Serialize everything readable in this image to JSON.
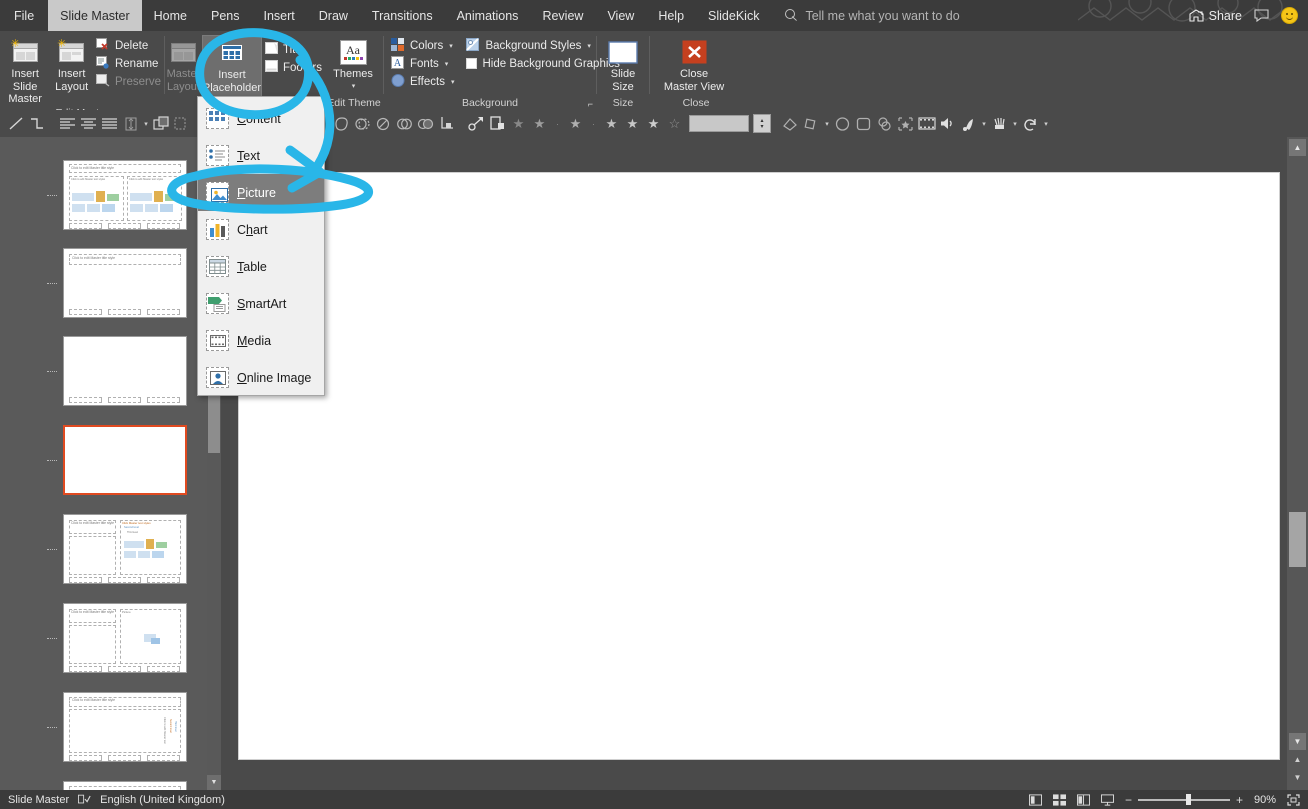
{
  "app": {
    "title_tabs": [
      {
        "label": "File",
        "active": false
      },
      {
        "label": "Slide Master",
        "active": true
      },
      {
        "label": "Home",
        "active": false
      },
      {
        "label": "Pens",
        "active": false
      },
      {
        "label": "Insert",
        "active": false
      },
      {
        "label": "Draw",
        "active": false
      },
      {
        "label": "Transitions",
        "active": false
      },
      {
        "label": "Animations",
        "active": false
      },
      {
        "label": "Review",
        "active": false
      },
      {
        "label": "View",
        "active": false
      },
      {
        "label": "Help",
        "active": false
      },
      {
        "label": "SlideKick",
        "active": false
      }
    ],
    "tell_me": "Tell me what you want to do",
    "share_label": "Share"
  },
  "ribbon": {
    "groups": [
      {
        "name": "Edit Master",
        "label": "Edit Master",
        "big_buttons": [
          {
            "label_line1": "Insert Slide",
            "label_line2": "Master",
            "icon": "insert-slide-master-icon",
            "disabled": false
          },
          {
            "label_line1": "Insert",
            "label_line2": "Layout",
            "icon": "insert-layout-icon",
            "disabled": false
          }
        ],
        "small_buttons": [
          {
            "label": "Delete",
            "icon": "delete-icon",
            "disabled": false
          },
          {
            "label": "Rename",
            "icon": "rename-icon",
            "disabled": false
          },
          {
            "label": "Preserve",
            "icon": "preserve-icon",
            "disabled": true
          }
        ]
      },
      {
        "name": "Master Layout",
        "label": "",
        "big_buttons": [
          {
            "label_line1": "Master",
            "label_line2": "Layout",
            "icon": "master-layout-icon",
            "disabled": true
          },
          {
            "label_line1": "Insert",
            "label_line2": "Placeholder",
            "icon": "insert-placeholder-icon",
            "disabled": false,
            "has_caret": true,
            "active": true
          }
        ],
        "checkboxes": [
          {
            "label": "Title",
            "checked": false
          },
          {
            "label": "Footers",
            "checked": false
          }
        ]
      },
      {
        "name": "Edit Theme",
        "label": "Edit Theme",
        "big_buttons": [
          {
            "label_line1": "Themes",
            "label_line2": "",
            "icon": "themes-icon",
            "has_caret": true
          }
        ]
      },
      {
        "name": "Background",
        "label": "Background",
        "small_buttons": [
          {
            "label": "Colors",
            "icon": "colors-icon",
            "has_caret": true
          },
          {
            "label": "Fonts",
            "icon": "fonts-icon",
            "has_caret": true
          },
          {
            "label": "Effects",
            "icon": "effects-icon",
            "has_caret": true
          },
          {
            "label": "Background Styles",
            "icon": "background-styles-icon",
            "has_caret": true
          },
          {
            "label": "Hide Background Graphics",
            "icon": "checkbox-icon",
            "checked": false
          }
        ],
        "dialog_launcher": true
      },
      {
        "name": "Size",
        "label": "Size",
        "big_buttons": [
          {
            "label_line1": "Slide",
            "label_line2": "Size",
            "icon": "slide-size-icon",
            "has_caret": true
          }
        ]
      },
      {
        "name": "Close",
        "label": "Close",
        "big_buttons": [
          {
            "label_line1": "Close",
            "label_line2": "Master View",
            "icon": "close-master-view-icon"
          }
        ]
      }
    ]
  },
  "placeholder_menu": {
    "items": [
      {
        "label": "Content",
        "accesskey": "C",
        "icon": "content-placeholder-icon",
        "highlighted": false
      },
      {
        "label": "Text",
        "accesskey": "T",
        "icon": "text-placeholder-icon",
        "highlighted": false
      },
      {
        "label": "Picture",
        "accesskey": "P",
        "icon": "picture-placeholder-icon",
        "highlighted": true
      },
      {
        "label": "Chart",
        "accesskey": "h",
        "icon": "chart-placeholder-icon",
        "highlighted": false
      },
      {
        "label": "Table",
        "accesskey": "T",
        "icon": "table-placeholder-icon",
        "highlighted": false
      },
      {
        "label": "SmartArt",
        "accesskey": "S",
        "icon": "smartart-placeholder-icon",
        "highlighted": false
      },
      {
        "label": "Media",
        "accesskey": "M",
        "icon": "media-placeholder-icon",
        "highlighted": false
      },
      {
        "label": "Online Image",
        "accesskey": "O",
        "icon": "online-image-placeholder-icon",
        "highlighted": false
      }
    ]
  },
  "thumbnails": [
    {
      "index": 1,
      "selected": false,
      "title_text": "Click to edit Master title style",
      "kind": "two-content"
    },
    {
      "index": 2,
      "selected": false,
      "title_text": "Click to edit Master title style",
      "kind": "title-only"
    },
    {
      "index": 3,
      "selected": false,
      "title_text": "",
      "kind": "blank-footer"
    },
    {
      "index": 4,
      "selected": true,
      "title_text": "",
      "kind": "blank"
    },
    {
      "index": 5,
      "selected": false,
      "title_text": "Click to edit Master title style",
      "kind": "content-with-caption"
    },
    {
      "index": 6,
      "selected": false,
      "title_text": "Click to edit Master title style",
      "kind": "picture-with-caption"
    },
    {
      "index": 7,
      "selected": false,
      "title_text": "Click to edit Master title style",
      "kind": "vertical-title-text"
    }
  ],
  "statusbar": {
    "view_name": "Slide Master",
    "language": "English (United Kingdom)",
    "spellcheck_icon": "spellcheck-icon",
    "view_buttons": [
      {
        "name": "normal-view-button",
        "icon": "normal-view-icon"
      },
      {
        "name": "slide-sorter-button",
        "icon": "slide-sorter-icon"
      },
      {
        "name": "reading-view-button",
        "icon": "reading-view-icon"
      },
      {
        "name": "slideshow-button",
        "icon": "slideshow-icon"
      }
    ],
    "zoom_out_label": "−",
    "zoom_in_label": "+",
    "zoom_level": "90%",
    "fit_label": "fit-to-window-icon"
  },
  "colors": {
    "annotation": "#29b6e8",
    "selected_thumb_border": "#e04a20",
    "ribbon_bg": "#4a4a4a",
    "titlebar_bg": "#3b3b3b",
    "menu_bg": "#f0f0f0",
    "menu_highlight": "#7d7d7d",
    "close_master_red": "#c5401f"
  }
}
